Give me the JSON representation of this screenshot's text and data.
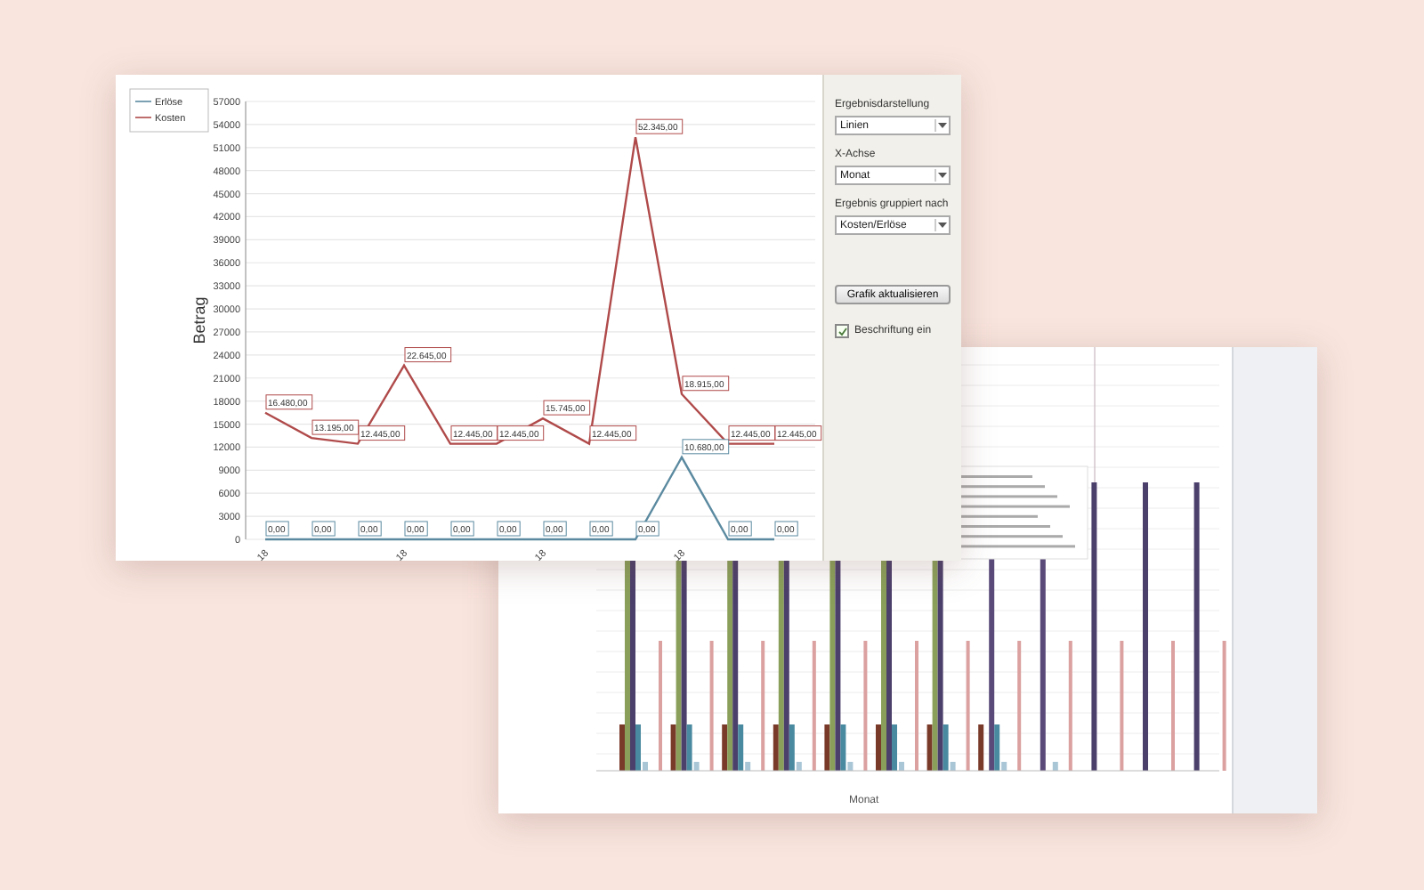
{
  "front_window": {
    "chart": {
      "chart_data": {
        "type": "line",
        "ylabel": "Betrag",
        "categories": [
          "18",
          null,
          null,
          "18",
          null,
          null,
          "18",
          null,
          null,
          "18",
          null,
          null
        ],
        "yticks": [
          0,
          3000,
          6000,
          9000,
          12000,
          15000,
          18000,
          21000,
          24000,
          27000,
          30000,
          33000,
          36000,
          39000,
          42000,
          45000,
          48000,
          51000,
          54000,
          57000
        ],
        "ylim": [
          0,
          57000
        ],
        "data_labels": true,
        "grid": true,
        "legend": true,
        "series": [
          {
            "name": "Erlöse",
            "color": "#5b8aa0",
            "values": [
              0,
              0,
              0,
              0,
              0,
              0,
              0,
              0,
              0,
              10680,
              0,
              0
            ],
            "value_labels": [
              "0,00",
              "0,00",
              "0,00",
              "0,00",
              "0,00",
              "0,00",
              "0,00",
              "0,00",
              "0,00",
              "10.680,00",
              "0,00",
              "0,00"
            ]
          },
          {
            "name": "Kosten",
            "color": "#b04a4a",
            "values": [
              16480,
              13195,
              12445,
              22645,
              12445,
              12445,
              15745,
              12445,
              52345,
              18915,
              12445,
              12445
            ],
            "value_labels": [
              "16.480,00",
              "13.195,00",
              "12.445,00",
              "22.645,00",
              "12.445,00",
              "12.445,00",
              "15.745,00",
              "12.445,00",
              "52.345,00",
              "18.915,00",
              "12.445,00",
              "12.445,00"
            ]
          }
        ]
      }
    },
    "panel": {
      "fields": [
        {
          "label": "Ergebnisdarstellung",
          "value": "Linien"
        },
        {
          "label": "X-Achse",
          "value": "Monat"
        },
        {
          "label": "Ergebnis gruppiert nach",
          "value": "Kosten/Erlöse"
        }
      ],
      "button": "Grafik aktualisieren",
      "checkbox": {
        "label": "Beschriftung ein",
        "checked": true
      }
    }
  },
  "back_window": {
    "chart": {
      "xlabel": "Monat"
    }
  }
}
